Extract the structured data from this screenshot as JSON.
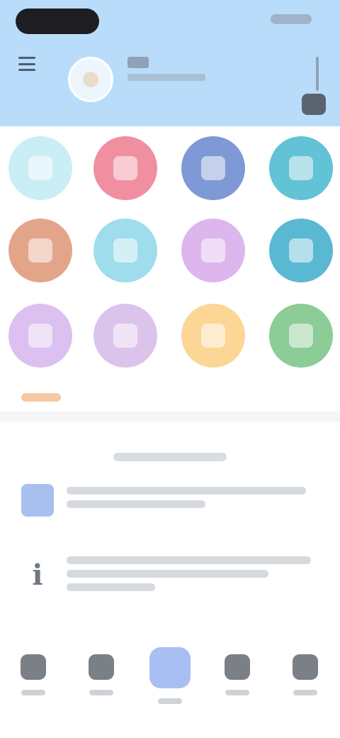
{
  "header": {
    "name": "",
    "subtitle": "",
    "colors": {
      "background": "#b9dcfa",
      "status_pill": "#1d1d22"
    }
  },
  "services": [
    {
      "label": "",
      "color": "#c9eef5",
      "icon": "service-icon"
    },
    {
      "label": "",
      "color": "#f08fa0",
      "icon": "service-icon"
    },
    {
      "label": "",
      "color": "#7f98d6",
      "icon": "service-icon"
    },
    {
      "label": "",
      "color": "#62c2d6",
      "icon": "service-icon"
    },
    {
      "label": "",
      "color": "#e3a58a",
      "icon": "service-icon"
    },
    {
      "label": "",
      "color": "#9fdcec",
      "icon": "service-icon"
    },
    {
      "label": "",
      "color": "#dcb6ec",
      "icon": "service-icon"
    },
    {
      "label": "",
      "color": "#5bb8d2",
      "icon": "service-icon"
    },
    {
      "label": "",
      "color": "#dcc0ef",
      "icon": "service-icon"
    },
    {
      "label": "",
      "color": "#dcc3ec",
      "icon": "service-icon"
    },
    {
      "label": "",
      "color": "#fbd695",
      "icon": "service-icon"
    },
    {
      "label": "",
      "color": "#8ccc96",
      "icon": "service-icon"
    }
  ],
  "notices": {
    "title": "",
    "items": [
      {
        "icon": "document-icon",
        "text": ""
      },
      {
        "icon": "info-icon",
        "text": ""
      }
    ]
  },
  "bottom_nav": {
    "items": [
      {
        "label": "",
        "icon": "home-icon",
        "active": false
      },
      {
        "label": "",
        "icon": "grid-icon",
        "active": false
      },
      {
        "label": "",
        "icon": "center-icon",
        "active": true
      },
      {
        "label": "",
        "icon": "bell-icon",
        "active": false
      },
      {
        "label": "",
        "icon": "user-icon",
        "active": false
      }
    ],
    "active_color": "#a8bff3"
  }
}
